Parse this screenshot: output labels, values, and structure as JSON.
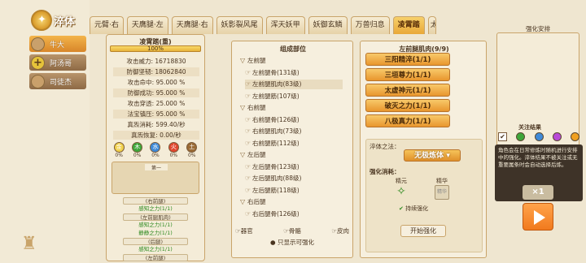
{
  "header": {
    "title": "淬体"
  },
  "characters": [
    {
      "name": "牛大",
      "active": true
    },
    {
      "name": "阿汤哥",
      "active": false
    },
    {
      "name": "司徒杰",
      "active": false
    }
  ],
  "tabs": [
    {
      "label": "元臂·右",
      "active": false
    },
    {
      "label": "天膺腿·左",
      "active": false
    },
    {
      "label": "天膺腿·右",
      "active": false
    },
    {
      "label": "妖影裂风尾",
      "active": false
    },
    {
      "label": "浑天妖甲",
      "active": false
    },
    {
      "label": "妖御玄鳞",
      "active": false
    },
    {
      "label": "万兽归息",
      "active": false
    },
    {
      "label": "凌霄踏",
      "active": true
    },
    {
      "label": "太",
      "active": false
    }
  ],
  "stat_panel": {
    "heading": "凌霄踏(重)",
    "progress_label": "100%",
    "progress": 1.0,
    "rows": [
      "攻击威力: 16718830",
      "防御坚韧: 18062840",
      "攻击命中: 95.000 %",
      "防御成功: 95.000 %",
      "攻击穿透: 25.000 %",
      "法宝镇压: 95.000 %",
      "真炁消耗: 599.40/秒",
      "真炁恢复: 0.00/秒"
    ],
    "elements": [
      {
        "glyph": "金",
        "color": "#f0d04a",
        "pct": "0%"
      },
      {
        "glyph": "木",
        "color": "#3ea63a",
        "pct": "0%"
      },
      {
        "glyph": "水",
        "color": "#3f8ad8",
        "pct": "0%"
      },
      {
        "glyph": "火",
        "color": "#e0462e",
        "pct": "0%"
      },
      {
        "glyph": "土",
        "color": "#9a6a34",
        "pct": "0%"
      }
    ],
    "stone_label": "第一",
    "badges": [
      {
        "text": "(右前腿)",
        "style": "grey"
      },
      {
        "text": "感知之力(1/1)",
        "style": "green"
      },
      {
        "text": "(左前腿肌肉)",
        "style": "grey"
      },
      {
        "text": "感知之力(1/1)",
        "style": "green"
      },
      {
        "text": "静静之力(1/1)",
        "style": "green"
      },
      {
        "text": "(后腿)",
        "style": "grey"
      },
      {
        "text": "感知之力(1/1)",
        "style": "green"
      },
      {
        "text": "(左前腿)",
        "style": "grey"
      }
    ]
  },
  "organ_panel": {
    "heading": "组成部位",
    "items": [
      {
        "label": "左前腿",
        "kind": "grp",
        "icon": "▽"
      },
      {
        "label": "左前腿骨(131级)",
        "kind": "sub",
        "icon": "☞"
      },
      {
        "label": "左前腿肌肉(83级)",
        "kind": "sub",
        "icon": "☞",
        "selected": true
      },
      {
        "label": "左前腿筋(107级)",
        "kind": "sub",
        "icon": "☞"
      },
      {
        "label": "右前腿",
        "kind": "grp",
        "icon": "▽"
      },
      {
        "label": "右前腿骨(126级)",
        "kind": "sub",
        "icon": "☞"
      },
      {
        "label": "右前腿肌肉(73级)",
        "kind": "sub",
        "icon": "☞"
      },
      {
        "label": "右前腿筋(112级)",
        "kind": "sub",
        "icon": "☞"
      },
      {
        "label": "左后腿",
        "kind": "grp",
        "icon": "▽"
      },
      {
        "label": "左后腿骨(123级)",
        "kind": "sub",
        "icon": "☞"
      },
      {
        "label": "左后腿肌肉(88级)",
        "kind": "sub",
        "icon": "☞"
      },
      {
        "label": "左后腿筋(118级)",
        "kind": "sub",
        "icon": "☞"
      },
      {
        "label": "右后腿",
        "kind": "grp",
        "icon": "▽"
      },
      {
        "label": "右后腿骨(126级)",
        "kind": "sub",
        "icon": "☞"
      }
    ],
    "legend": [
      "器官",
      "骨骼",
      "皮肉"
    ],
    "show_upgradable": "只显示可强化"
  },
  "detail_panel": {
    "heading": "左前腿肌肉(9/9)",
    "skills": [
      "三阳精淬(1/1)",
      "三垣尊力(1/1)",
      "太虚神元(1/1)",
      "破灭之力(1/1)",
      "八极真力(1/1)"
    ],
    "method_label": "淬体之法：",
    "method_value": "无极炼体",
    "cost_label": "强化消耗：",
    "essence_label": "精元",
    "spirit_label": "精华",
    "spirit_tag": "精华",
    "keep_label": "持续强化",
    "start_label": "开始强化"
  },
  "right_panel": {
    "heading": "强化安排",
    "result_title": "关注结果",
    "filter_colors": [
      "#3ea63a",
      "#3f8ad8",
      "#b84ad8",
      "#f0a020"
    ],
    "note": "角色会在日常修炼时随机进行安排中的强化。淬体结果不被关注或无重要属条时会自动选择后炼。",
    "multiplier": "×1"
  }
}
